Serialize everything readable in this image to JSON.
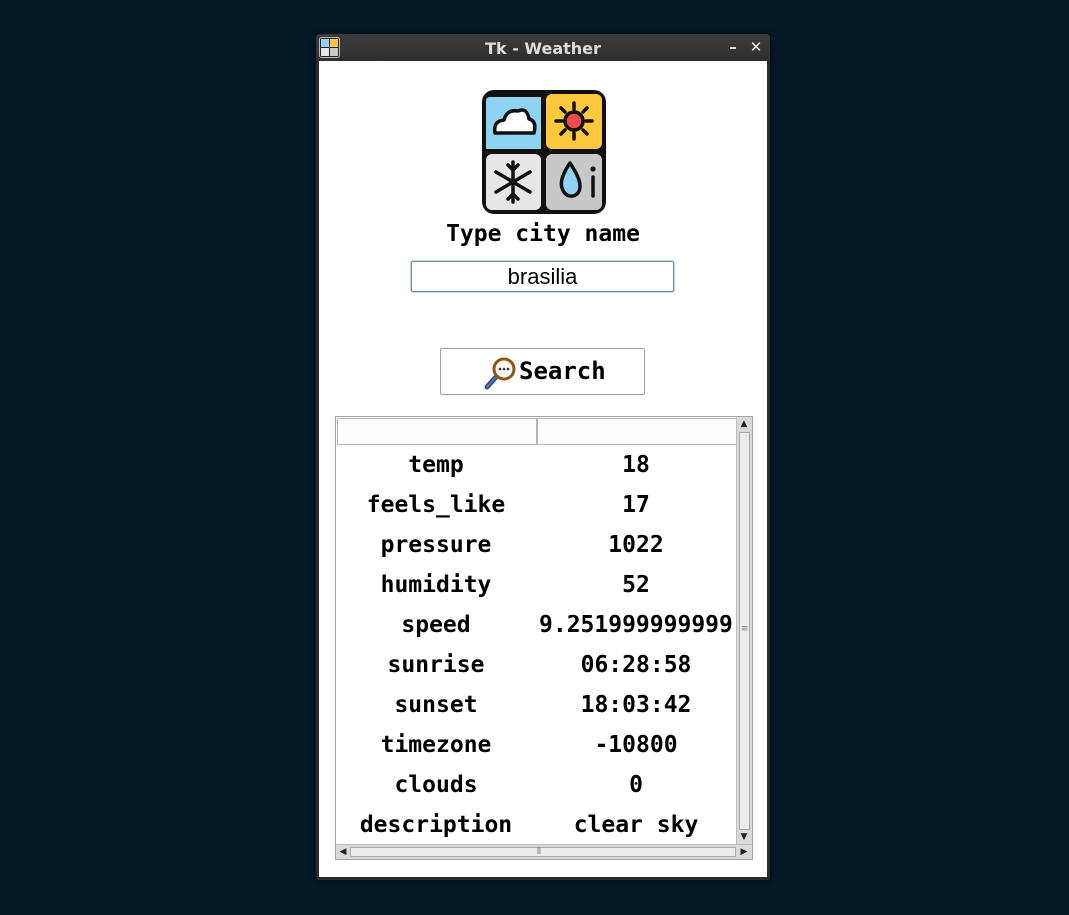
{
  "window": {
    "title": "Tk - Weather",
    "minimize_glyph": "–",
    "close_glyph": "✕"
  },
  "prompt": "Type city name",
  "city_input": {
    "value": "brasilia"
  },
  "search_button": {
    "label": "Search",
    "icon": "magnifier-icon"
  },
  "table": {
    "headers": [
      "",
      ""
    ],
    "rows": [
      {
        "key": "temp",
        "value": "18"
      },
      {
        "key": "feels_like",
        "value": "17"
      },
      {
        "key": "pressure",
        "value": "1022"
      },
      {
        "key": "humidity",
        "value": "52"
      },
      {
        "key": "speed",
        "value": "9.251999999999"
      },
      {
        "key": "sunrise",
        "value": "06:28:58"
      },
      {
        "key": "sunset",
        "value": "18:03:42"
      },
      {
        "key": "timezone",
        "value": "-10800"
      },
      {
        "key": "clouds",
        "value": "0"
      },
      {
        "key": "description",
        "value": "clear sky"
      }
    ]
  },
  "colors": {
    "desktop": "#051826",
    "logo_cloud_bg": "#8fd3f3",
    "logo_sun_bg": "#ffc83d",
    "logo_snow_bg": "#e6e6e6",
    "logo_drop_bg": "#c8c8c8",
    "sun_core": "#f04a4a"
  }
}
